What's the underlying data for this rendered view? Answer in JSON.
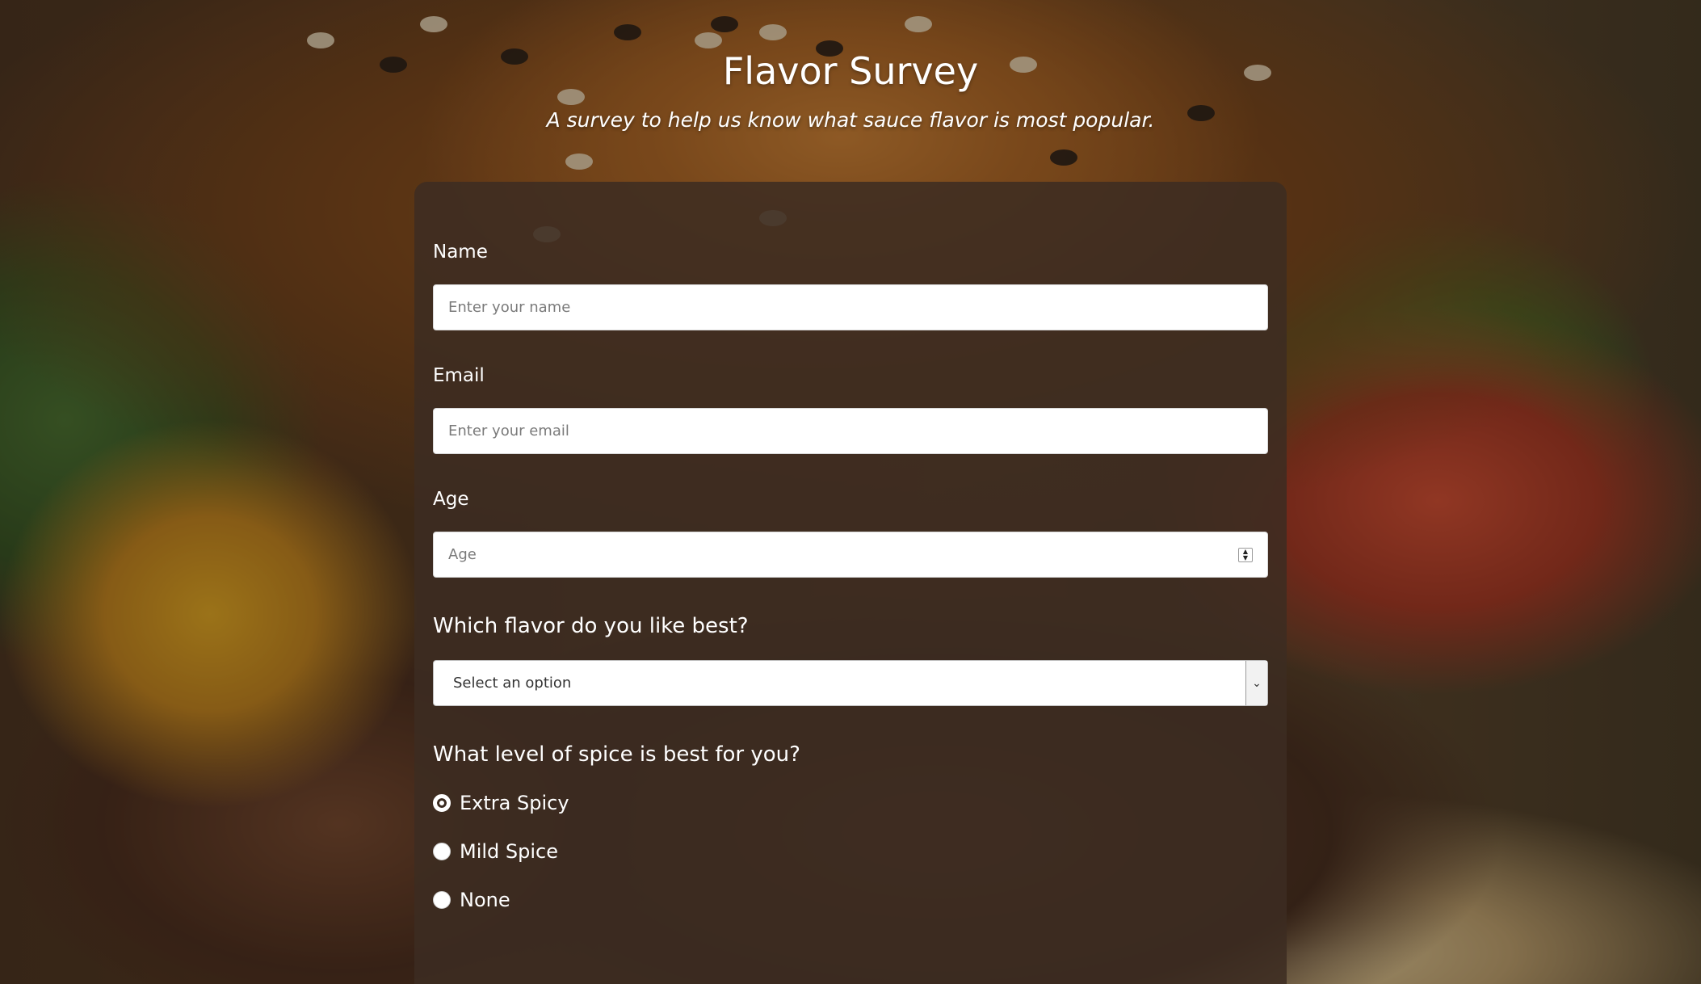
{
  "header": {
    "title": "Flavor Survey",
    "description": "A survey to help us know what sauce flavor is most popular."
  },
  "form": {
    "name": {
      "label": "Name",
      "placeholder": "Enter your name",
      "value": ""
    },
    "email": {
      "label": "Email",
      "placeholder": "Enter your email",
      "value": ""
    },
    "age": {
      "label": "Age",
      "placeholder": "Age",
      "value": ""
    },
    "flavor": {
      "label": "Which flavor do you like best?",
      "selected": "Select an option"
    },
    "spice": {
      "label": "What level of spice is best for you?",
      "options": [
        {
          "label": "Extra Spicy",
          "checked": true
        },
        {
          "label": "Mild Spice",
          "checked": false
        },
        {
          "label": "None",
          "checked": false
        }
      ]
    }
  },
  "colors": {
    "card_background": "#3c2c22",
    "text": "#ffffff",
    "input_background": "#ffffff",
    "placeholder": "#7a7a7a"
  },
  "icons": {
    "select_arrow": "chevron-down-icon",
    "number_spinner": "spinner-arrows-icon"
  }
}
